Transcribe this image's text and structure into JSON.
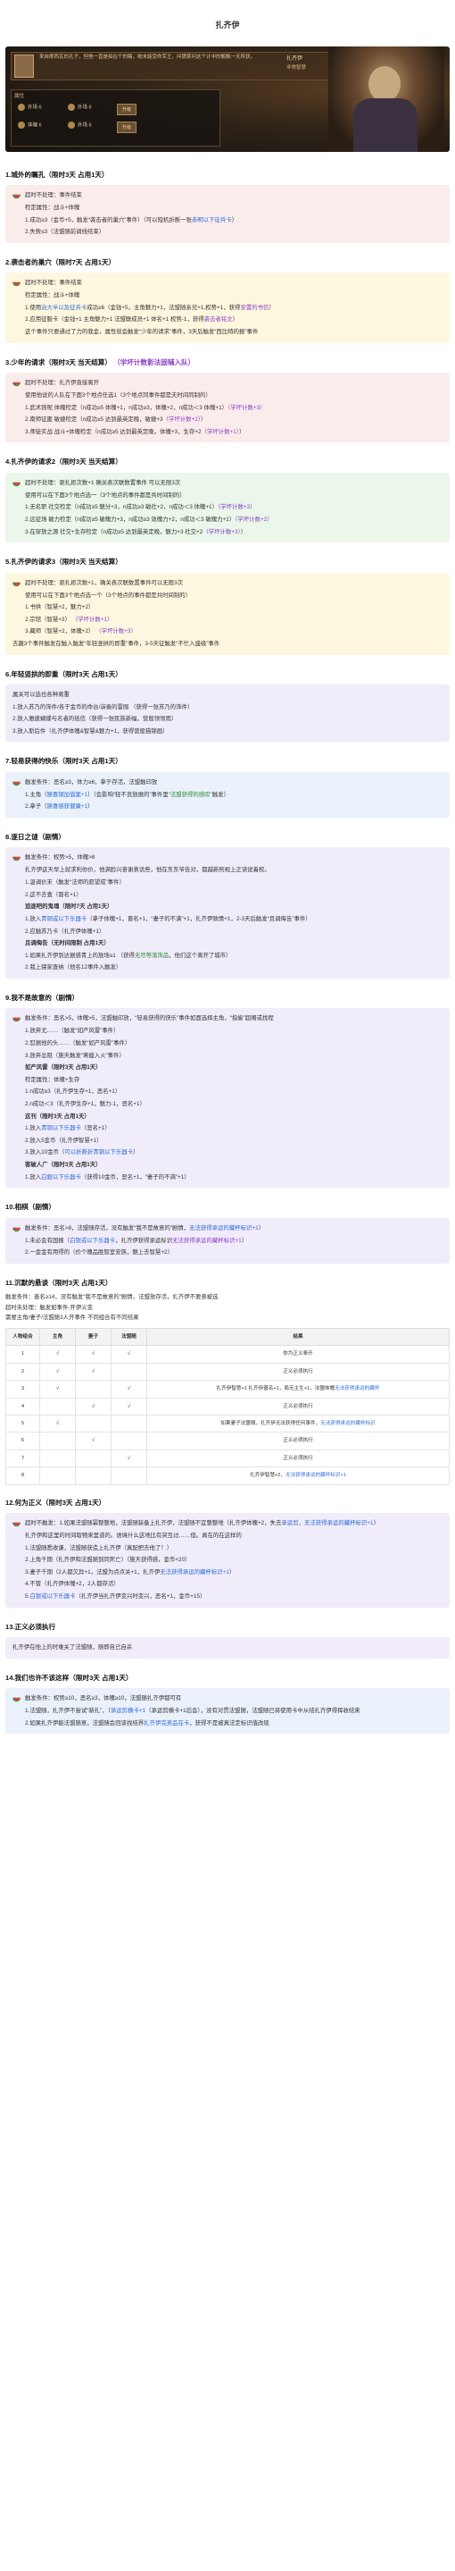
{
  "page": {
    "title": "扎齐伊"
  },
  "banner": {
    "description": "来自摩西瓦的孔子，但他一直是拍在个的瞎，她未能受命军王，问牌某何这个计中的甄甄一无所获。",
    "name": "扎齐伊",
    "subtitle": "非常智慧",
    "panel_title": "属性",
    "stats": [
      "外场",
      "外场",
      "体魄",
      "外场"
    ],
    "stat_values": [
      "6",
      "6",
      "6",
      "6"
    ],
    "button": "升级"
  },
  "icons": {
    "bullet": "watermelon-icon"
  },
  "colors": {
    "blue": "#2b6cd8",
    "purple": "#8b3fc8",
    "green": "#2a8a3a",
    "red": "#d03030",
    "orange": "#d87a10"
  },
  "sections": {
    "s1": {
      "heading": "1.城外的瞩孔（限时3天 占用1天）",
      "rows": [
        "超时不处理：事件结束",
        "检定属性：战斗+体魄",
        "1.成功≥3（金币+5，触发“袭击者的巢穴”事件）（可以短机折断一张",
        "2.失败≤3（法盟随前调线结束）"
      ],
      "row1_blue": "赤明以下征兵卡",
      "row1_tail": "）"
    },
    "s2": {
      "heading": "2.袭击者的巢穴（限时7天 占用1天）",
      "rows": [
        "超时不处理：事件结束",
        "检定属性：战斗+体魄",
        "1.使用",
        "2.应用征服卡（金钱+1 主角魅力+1 法盟联成员+1 体名+1 权势-1，获得",
        "这个事件只要通过了力的我金，属性就会触发“少年的请求”事件，3天后触发“西比特的报”事件"
      ],
      "row3_blue": "治大半以及征兵卡",
      "row3_mid": "成功≥6（金钱+5，主角魅力+1，法盟随亲兄+1,权势+1，获得",
      "row3_purple": "安置的书信",
      "row3_tail": "）",
      "row4_purple": "袭击者铭文",
      "row4_tail": "）"
    },
    "s3": {
      "heading": "3.少年的请求（限时3天 当天结算）",
      "heading_link": "（学坏计数影法固辅入队）",
      "rows": [
        "超时不处理：扎齐伊直接离开",
        "使用他说的人队在下面3个地点任选1（3个地点同事件都是夫时间同制的）",
        "1.武术则呢 体魄检定（n成功≥5 体魄+1，n成功≥3，体魄+2，n成功＜3 体魄+1）",
        "2.南师征匿 敏捷检定（n成功≥5 达到最英定晚，敏捷+3",
        "3.师徒实战 战斗+体魄检定（n成功≥5 达到最英定晚，体魄+3，生存+2"
      ],
      "row3_purple": "（学坏计数+3）",
      "row4_purple": "（学坏计数+2）",
      "row5_purple": "（学坏计数+1）"
    },
    "s4": {
      "heading": "4.扎齐伊的请求2（限时3天 当天结算）",
      "rows": [
        "超时不处理：驱扎拒次数+1 确关表次联数置事件 可以无限3次",
        "使用可以在下面3个地点选一（3个地点的事件都是共时间制的）",
        "1.无名职 社交检定（n成功≥5 魅分+3，n成功≥3 敏社+2，n成功＜3 体魄+1）",
        "2.远征场 敏力检定（n成功≥5 敏魄力+3，n成功≥3 效魄力+2，n成功＜3 敏魄力+1）",
        "3.在穿放之源 社交+生存检定（n成功≥5 达到最英定晚，魅力+3 社交+2"
      ],
      "row3_purple": "（学坏计数+3）",
      "row4_purple": "（学坏计数+2）",
      "row5_purple": "（学坏计数+3）"
    },
    "s5": {
      "heading": "5.扎齐伊的请求3（限时3天 当天结算）",
      "rows": [
        "超时不处理：驱扎拒次数+1，确关表次联数置事件可以无限3次",
        "使用可以在下面3个地点选一个（3个地点的事件都是共时间制的）",
        "1.书供（智慧+2，魅力+2）",
        "2.宗馆（智慧+3）",
        "3.藏师（智慧+2，体魄+2）",
        "去趣3个事件触发在触入触发“年轻竖拱的即重”事件，3-5天征触发“不忙入盛级”事件"
      ],
      "row4_purple": "（学坏计数+1）",
      "row5_purple": "（学坏计数+3）"
    },
    "s6": {
      "heading": "6.年轻竖拱的即重（限时3天 占用1天）",
      "rows": [
        "属关可以选也各种离重",
        "1.放入苏乃的饰件/各于金币的命台/演奏的雷围 （获得一张苏乃的饰件）",
        "2.放入雅披蝴蝶与名者的纸信（获得一张民族新幅，营般领领雨）",
        "3.放入斯后件（扎齐伊体魄&智慧&魅力+1，获得营般猫锦画）"
      ]
    },
    "s7": {
      "heading": "7.轻易获得的快乐（限时3天 占用1天）",
      "rows": [
        "触发条件：恶名≥3，体力≥6，拿于存活，法盟触印放",
        "1.主角（",
        "2.拿子（"
      ],
      "row2_blue": "随喜钢加值案+1",
      "row2_tail": "）（会影响“轻不良放展的”事件里",
      "row2_green": "“法盟获得的感叹”",
      "row2_end": "触发）",
      "row3_blue": "随喜偿获健康+1",
      "row3_tail": "）"
    },
    "s8": {
      "heading": "8.逐日之谜（剧情）",
      "intro": [
        "触发条件：权势>5，体魄>8",
        "扎齐伊这天早上就求利你价，他满脸兴奋谢表话些，他在东东爷告对，都越新刑视上正读说着权。",
        "1.温调价末（触发“法师的愿望成”事件）",
        "2.这不去查（晋名+1）"
      ],
      "sub1_title": "追逐吧的鬼魂（限时7天 占用1天）",
      "sub1_rows": [
        "1.放入",
        "2.应触苏乃卡（扎齐伊体魄+1）"
      ],
      "sub1_blue": "青铜或以下乐器卡",
      "sub1_tail": "（拿子体魄+1，晋名+1，“妻子的不满”+1，扎齐伊致情+1，2-3天后触发“且调侮告”事件）",
      "sub2_title": "且调侮告（无时间限制 占用1天）",
      "sub2_rows": [
        "1.如果扎齐伊到达据感青上的放场≥1 （获得",
        "2.我上寝家查纳（他名12事件入触发）"
      ],
      "sub2_green": "无尽等落饰品",
      "sub2_tail": "，他们这个离开了城市）"
    },
    "s9": {
      "heading": "9.我不是故意的（剧情）",
      "intro": [
        "触发条件：恶名>5，体魄>5，法盟触印放，“轻易获得的快乐”事件如面选择主角，“指偷”超阁或找程",
        "1.放弃尤……（触发“如产风雷”事件）",
        "2.怼据他的头……（触发“如产风雷”事件）",
        "3.放弃怂阻（施天触发“寒蝗入火”事件）"
      ],
      "sub1_title": "如产风雷（限时3天 占用1天）",
      "sub1_rows": [
        "检定属性：体魄+生存",
        "1.n成功≥3（扎齐伊生存+1，恶名+1）",
        "2.n成功＜3（扎齐伊生存+1，魅力-1，恶名+1）"
      ],
      "sub2_title": "这刊（限时3天 占用1天）",
      "sub2_rows": [
        "1.放入",
        "2.放入5金币（扎齐伊智慧+1）",
        "3.放入10金币（"
      ],
      "sub2_row1_blue": "青铜以下乐器卡",
      "sub2_row1_tail": "（恶名+1）",
      "sub2_row3_blue": "可以折断折青铜以下乐器卡",
      "sub2_row3_tail": "）",
      "sub3_title": "客破人广（限时3天 占用1天）",
      "sub3_rows": [
        "1.放入"
      ],
      "sub3_blue": "白銀以下乐器卡",
      "sub3_tail": "（获得10金币，恶名+1，“妻子的不满”+1）"
    },
    "s10": {
      "heading": "10.相棋（剧情）",
      "rows": [
        "触发条件：恶名>8，法盟随存活，没有触发“我不是故意的”剧情，",
        "1.未必会有国报（",
        "2.一金金有用得的（价个魄品胜智室安族，魅上去智慧+2）"
      ],
      "row1_blue": "无法获得承运的藏杯标识+1",
      "row1_tail": "）",
      "row2_blue": "白银或以下乐器卡",
      "row2_mid": "，扎齐伊获得承运标识",
      "row2_purple": "无法获得承运的藏杯标识+1",
      "row2_tail": "）"
    },
    "s11": {
      "heading": "11.沉默的悬谈（限时3天 占用1天）",
      "plain": [
        "触发条件：善名≥14，没有触发“我不是故意的”剧情，法盟放存活，扎齐伊不要意被选",
        "超时未处理：触发如事件-开伊义变",
        "需要主角/妻子/法盟随3人开事件 不同组合有不同结果"
      ],
      "table_headers": [
        "人物组合",
        "主角",
        "妻子",
        "法盟随",
        "结果"
      ],
      "table_rows": [
        {
          "id": "1",
          "a": "√",
          "b": "√",
          "c": "√",
          "r": "你为正义奉开"
        },
        {
          "id": "2",
          "a": "√",
          "b": "√",
          "c": "",
          "r": "正义必须执行"
        },
        {
          "id": "3",
          "a": "√",
          "b": "",
          "c": "√",
          "r": "扎齐伊智慧+1 扎齐伊善名+1，局无主生+1，法盟体魄"
        },
        {
          "id": "4",
          "a": "",
          "b": "√",
          "c": "√",
          "r": "正义必须执行"
        },
        {
          "id": "5",
          "a": "√",
          "b": "",
          "c": "",
          "r": "如果妻子法盟随，扎齐伊无法获得任何事件，"
        },
        {
          "id": "6",
          "a": "",
          "b": "√",
          "c": "",
          "r": "正义必须执行"
        },
        {
          "id": "7",
          "a": "",
          "b": "",
          "c": "√",
          "r": "正义必须执行"
        },
        {
          "id": "8",
          "a": "",
          "b": "",
          "c": "",
          "r": "扎齐伊智慧+2，"
        }
      ],
      "row3_blue": "无法获得承运的藏杯",
      "row5_blue": "无法获得承运的藏杯标识",
      "row8_blue": "无法获得承运的藏杯标识+1"
    },
    "s12": {
      "heading": "12.何为正义（限时3天 占用1天）",
      "rows": [
        "超时不触发：1.如果法盟随幂整整地，法盟随装备上扎齐伊，法盟随不宜整整地（扎齐伊体魄+2，失去",
        "扎齐伊和这里的时间取物来里道的。语境什么这地比有突互过……但。真在的在这样的",
        "1.法盟随悉收谦，法盟随获造上扎齐伊（真配把去他了！）",
        "2.上角千期（扎齐伊和法盟随到同死亡）（施天获得感，金币+20）",
        "3.妻子千期（2人都欠异+1，法盟为点点关+1，扎齐伊",
        "4.不管（扎齐伊体魄+2，2人都存活）",
        "5.",
        "（扎齐伊当扎齐伊变兴时变兴，恶名+1，金币+15）"
      ],
      "row1_blue": "承运剪，无法获得承运的藏杯标识+1",
      "row1_tail": "）",
      "row6_blue": "无法获得承运的藏杯标识+1",
      "row6_tail": "）",
      "row8_blue": "白银或以下乐器卡"
    },
    "s13": {
      "heading": "13.正义必须执行",
      "rows": [
        "扎齐伊在他上的时难关了法盟随，随即自己自杀"
      ]
    },
    "s14": {
      "heading": "14.我们也许不该这样（限时3天 占用1天）",
      "rows": [
        "触发条件：权势≥10，恶名≥3，体魄≥10，法盟随扎齐伊都可有",
        "1.法盟随，扎齐伊不尝试“新扎”，（",
        "2.如果扎齐伊能法盟随意，法盟随会回该找结界"
      ],
      "row1_blue": "承运剪横卡+1",
      "row1_mid": "（承运剪横卡+1后会），没有对贯法盟随，法盟随已将使用卡中从结扎齐伊得挥收结来",
      "row2_blue": "扎齐伊完美品在卡",
      "row2_tail": "，获得不是被真法定标识值改现"
    }
  }
}
